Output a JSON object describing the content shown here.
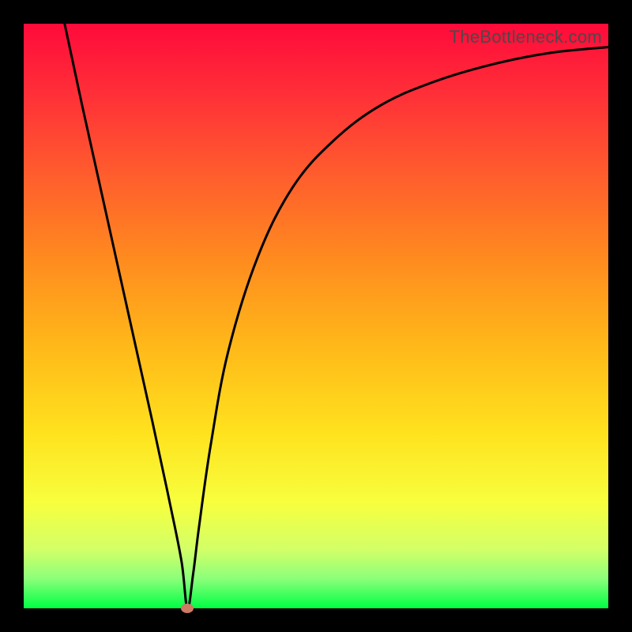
{
  "watermark": "TheBottleneck.com",
  "chart_data": {
    "type": "line",
    "title": "",
    "xlabel": "",
    "ylabel": "",
    "xlim": [
      0,
      100
    ],
    "ylim": [
      0,
      100
    ],
    "gradient_colors": [
      "#ff0a3a",
      "#ffe21e",
      "#00ff44"
    ],
    "marker": {
      "x": 28,
      "y": 0,
      "color": "#cf7a64"
    },
    "series": [
      {
        "name": "curve",
        "x": [
          7,
          10,
          14,
          18,
          22,
          25,
          27,
          28,
          29,
          30,
          32,
          35,
          40,
          46,
          53,
          61,
          70,
          80,
          90,
          100
        ],
        "values": [
          100,
          86,
          68,
          50,
          32,
          18,
          8,
          0,
          6,
          14,
          28,
          44,
          60,
          72,
          80,
          86,
          90,
          93,
          95,
          96
        ]
      }
    ]
  }
}
